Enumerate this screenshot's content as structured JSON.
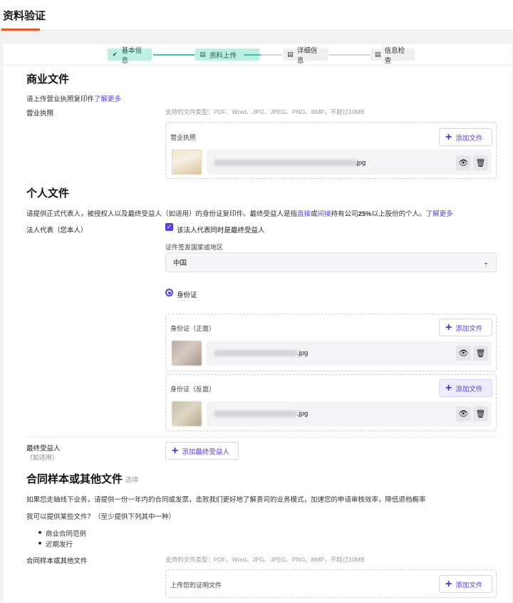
{
  "header": {
    "title": "资料验证"
  },
  "steps": [
    {
      "label": "基本信息",
      "icon": "✔",
      "state": "done"
    },
    {
      "label": "资料上传",
      "icon": "▤",
      "state": "current"
    },
    {
      "label": "详细信息",
      "icon": "▤",
      "state": "todo"
    },
    {
      "label": "信息检查",
      "icon": "▤",
      "state": "todo"
    }
  ],
  "business": {
    "heading": "商业文件",
    "desc_prefix": "请上传营业执照复印件",
    "desc_link": "了解更多",
    "row_label": "营业执照",
    "hint": "支持的文件类型：PDF、Word、JPG、JPEG、PNG、BMP，不超过10MB",
    "box_title": "营业执照",
    "add_label": "添加文件",
    "file_ext": ".jpg"
  },
  "personal": {
    "heading": "个人文件",
    "desc_a": "请提供正式代表人，被授权人以及最终受益人（如适用）的身份证复印件。最终受益人是指",
    "desc_link1": "直接",
    "desc_or": "或",
    "desc_link2": "间接",
    "desc_b": "持有公司",
    "desc_pct": "25%",
    "desc_c": "以上股份的个人。",
    "desc_link3": "了解更多",
    "legal_label": "法人代表（您本人）",
    "checkbox_label": "该法人代表同时是最终受益人",
    "country_label": "证件签发国家或地区",
    "country_value": "中国",
    "radio_label": "身份证",
    "id_front_title": "身份证（正面）",
    "id_back_title": "身份证（反面）",
    "add_label": "添加文件",
    "file_ext": ".jpg",
    "ubo_label": "最终受益人",
    "ubo_sub": "（如适用）",
    "add_ubo_label": "添加最终受益人"
  },
  "contract": {
    "heading": "合同样本或其他文件",
    "optional": "选填",
    "desc": "如果您走轴线下业务，请提供一份一年内的合同或发票，击败我们更好地了解贵司的业务模式，加速您的申请审核效率，降低退档概率",
    "question": "我可以提供某些文件？（至少提供下列其中一种）",
    "bullets": [
      "商业合同范例",
      "近期发行"
    ],
    "row_label": "合同样本或其他文件",
    "hint": "支持的文件类型：PDF、Word、JPG、JPEG、PNG、BMP，不超过10MB",
    "box_title": "上传您的证明文件",
    "add_label": "添加文件"
  }
}
